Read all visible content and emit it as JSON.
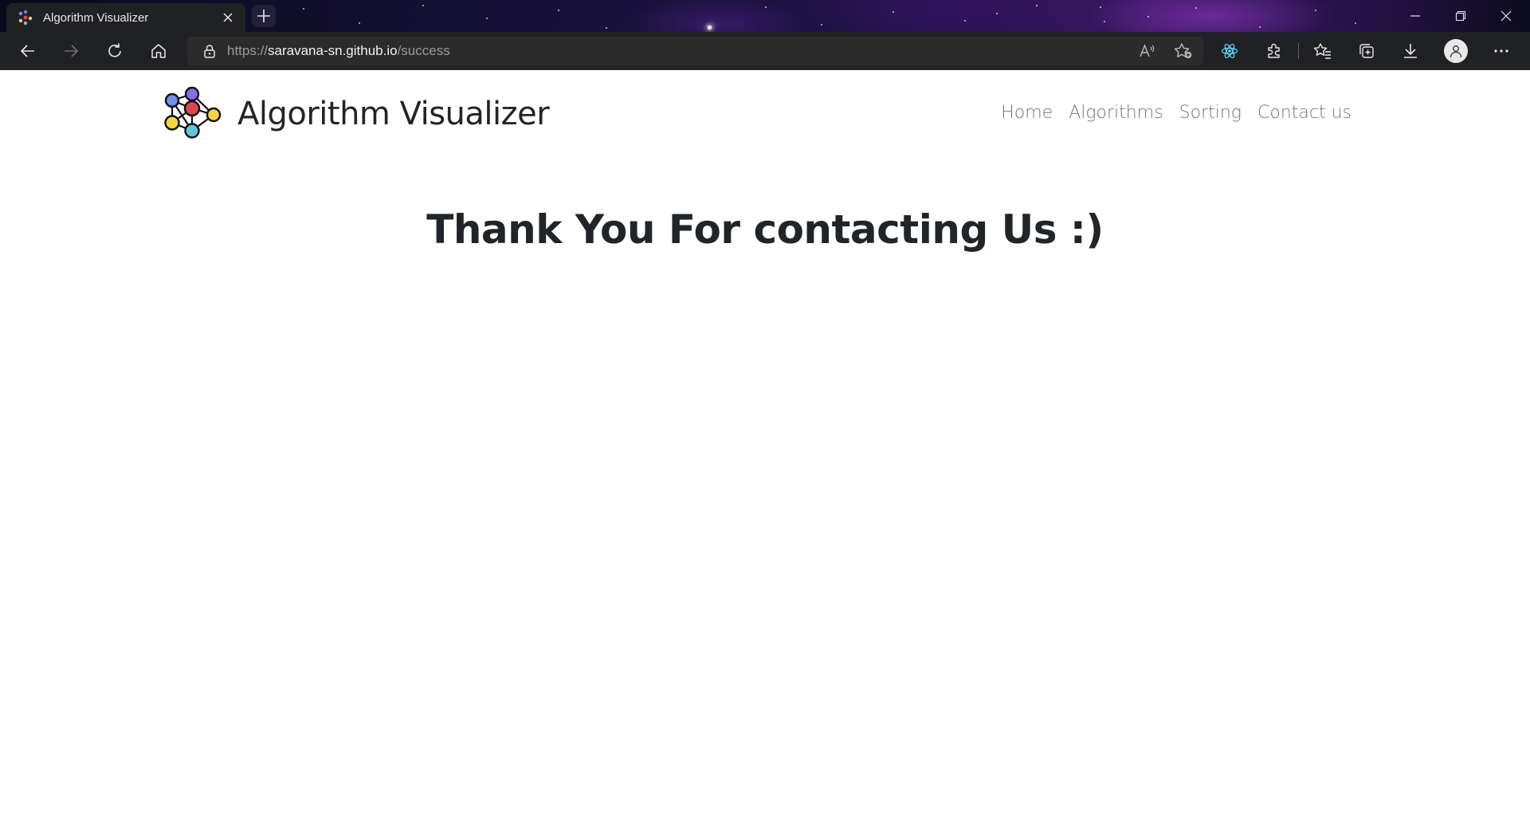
{
  "browser": {
    "tab": {
      "title": "Algorithm Visualizer"
    },
    "address": {
      "scheme": "https://",
      "host": "saravana-sn.github.io",
      "path": "/success"
    },
    "icons": [
      "back-icon",
      "forward-icon",
      "refresh-icon",
      "home-icon",
      "lock-icon",
      "read-aloud-icon",
      "add-favorite-icon",
      "react-devtools-icon",
      "extensions-icon",
      "favorites-icon",
      "collections-icon",
      "downloads-icon",
      "profile-icon",
      "more-icon",
      "minimize-icon",
      "restore-icon",
      "close-icon"
    ]
  },
  "site": {
    "brand": "Algorithm Visualizer",
    "nav": [
      {
        "label": "Home"
      },
      {
        "label": "Algorithms"
      },
      {
        "label": "Sorting"
      },
      {
        "label": "Contact us"
      }
    ]
  },
  "main": {
    "headline": "Thank You For contacting Us :)"
  },
  "colors": {
    "text": "#212529",
    "nav_link": "#6c757d",
    "logo_red": "#e0464f",
    "logo_purple": "#8a6cf0",
    "logo_blue": "#6f8df5",
    "logo_yellow": "#f5d63d",
    "logo_teal": "#5cc9e0"
  }
}
